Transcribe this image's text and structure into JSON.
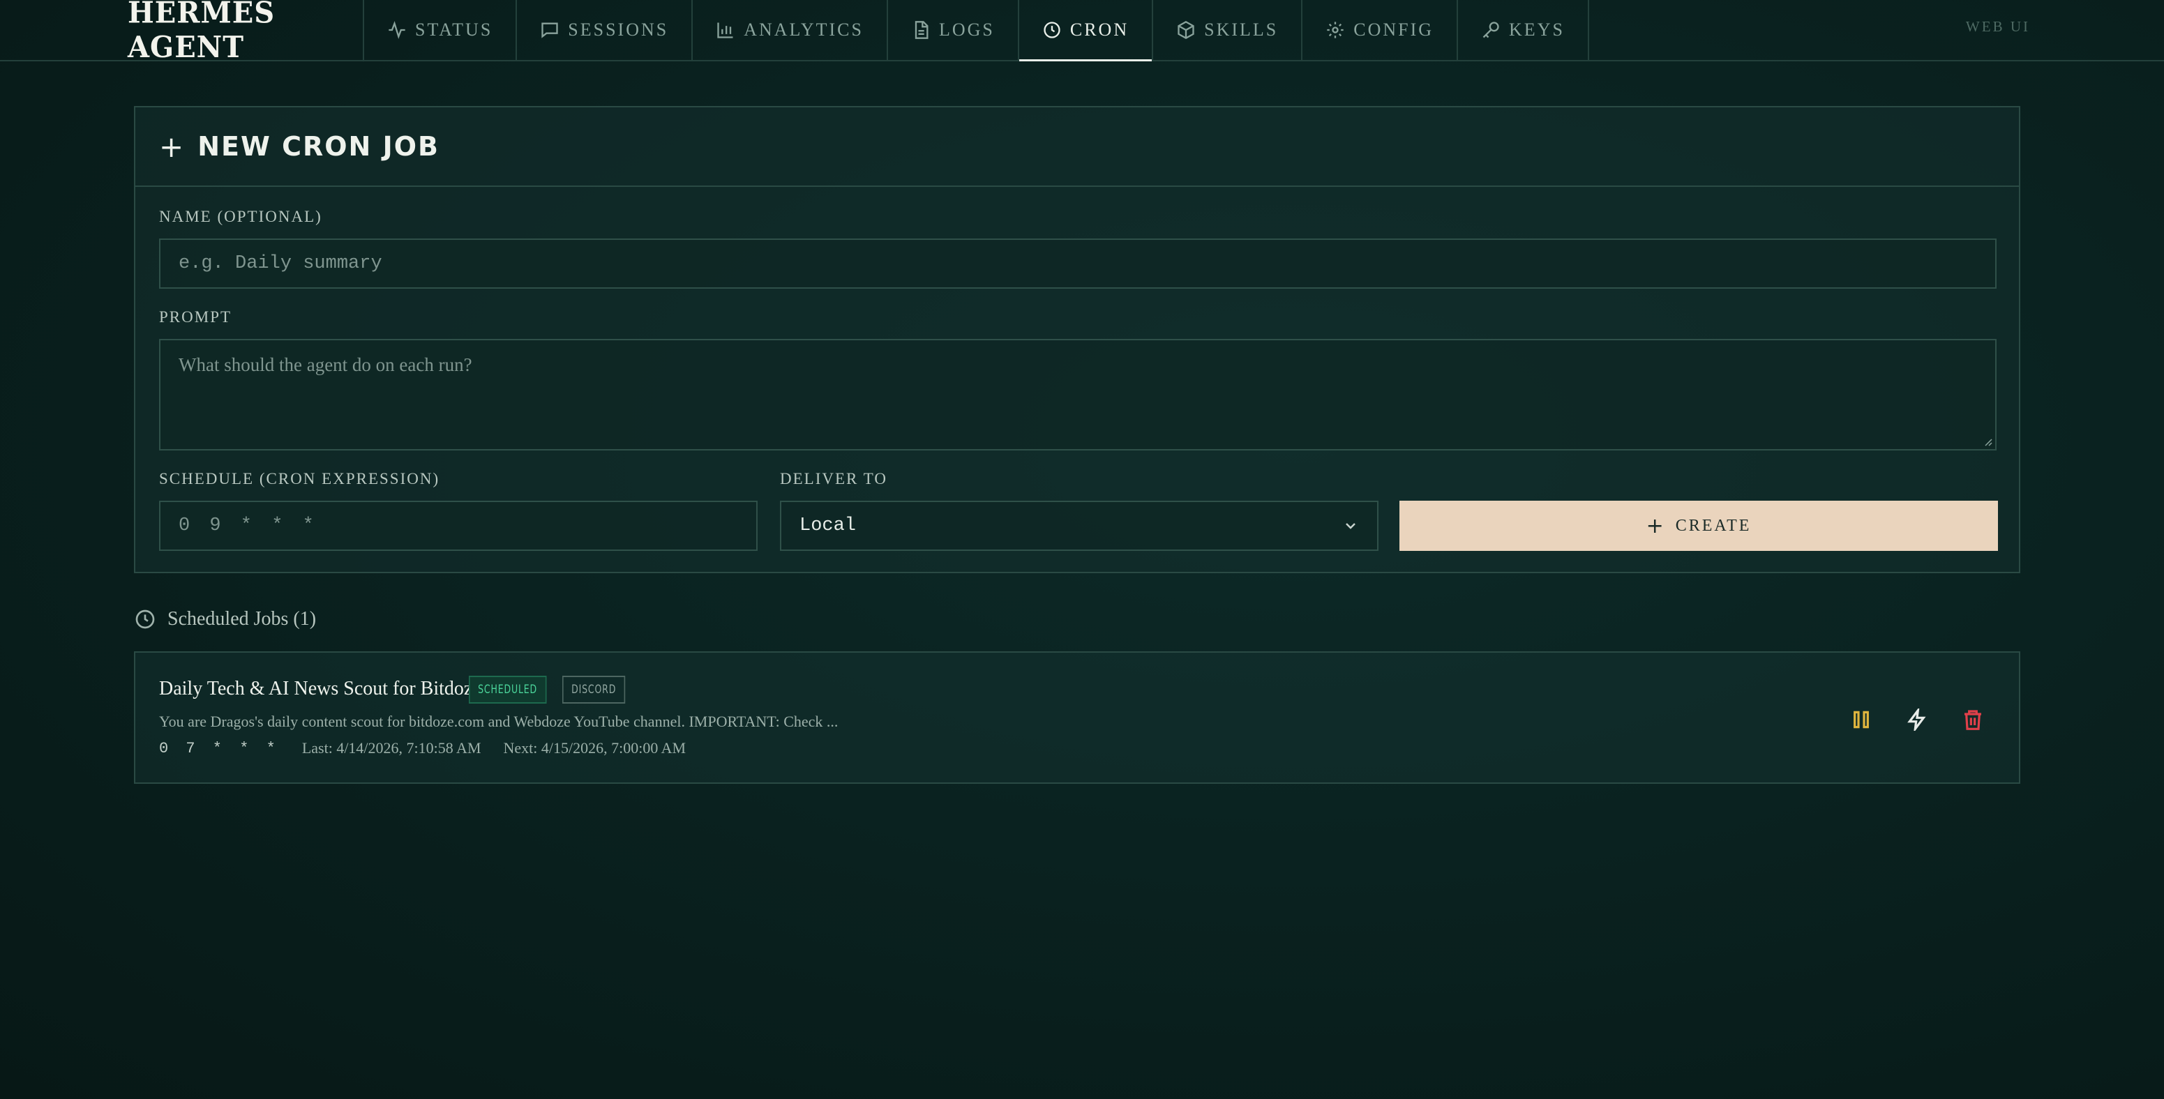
{
  "app": {
    "brand": "HERMES AGENT",
    "mode": "WEB UI"
  },
  "nav": {
    "tabs": [
      {
        "label": "STATUS",
        "icon": "activity-icon"
      },
      {
        "label": "SESSIONS",
        "icon": "chat-icon"
      },
      {
        "label": "ANALYTICS",
        "icon": "bar-chart-icon"
      },
      {
        "label": "LOGS",
        "icon": "file-icon"
      },
      {
        "label": "CRON",
        "icon": "clock-icon",
        "active": true
      },
      {
        "label": "SKILLS",
        "icon": "package-icon"
      },
      {
        "label": "CONFIG",
        "icon": "gear-icon"
      },
      {
        "label": "KEYS",
        "icon": "key-icon"
      }
    ]
  },
  "new_job": {
    "title": "NEW CRON JOB",
    "name_label": "NAME (OPTIONAL)",
    "name_placeholder": "e.g. Daily summary",
    "prompt_label": "PROMPT",
    "prompt_placeholder": "What should the agent do on each run?",
    "schedule_label": "SCHEDULE (CRON EXPRESSION)",
    "schedule_placeholder": "0 9 * * *",
    "deliver_label": "DELIVER TO",
    "deliver_value": "Local",
    "create_label": "CREATE"
  },
  "jobs": {
    "title": "Scheduled Jobs (1)",
    "items": [
      {
        "name": "Daily Tech & AI News Scout for Bitdoze",
        "status": "SCHEDULED",
        "channel": "DISCORD",
        "description": "You are Dragos's daily content scout for bitdoze.com and Webdoze YouTube channel. IMPORTANT: Check ...",
        "schedule": "0 7 * * *",
        "last": "Last: 4/14/2026, 7:10:58 AM",
        "next": "Next: 4/15/2026, 7:00:00 AM"
      }
    ]
  },
  "colors": {
    "pause": "#e0b53e",
    "run": "#e8ece9",
    "delete": "#e0404a",
    "create_bg": "#ead4bd",
    "scheduled": "#4bd49a"
  }
}
